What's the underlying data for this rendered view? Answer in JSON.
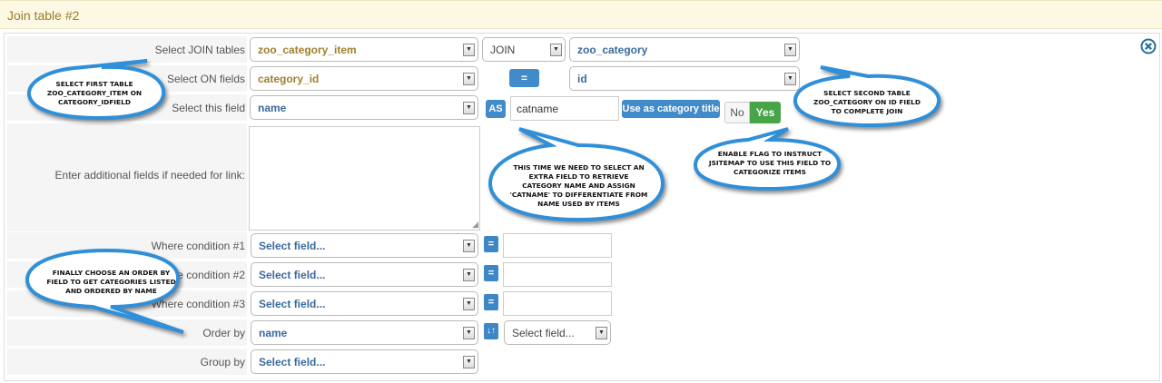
{
  "window": {
    "title": "Join table #2"
  },
  "rows": {
    "join_tables": {
      "label": "Select JOIN tables",
      "table1": "zoo_category_item",
      "join_type": "JOIN",
      "table2": "zoo_category"
    },
    "on_fields": {
      "label": "Select ON fields",
      "field1": "category_id",
      "operator": "=",
      "field2": "id"
    },
    "select_field": {
      "label": "Select this field",
      "field": "name",
      "as_label": "AS",
      "alias": "catname",
      "use_title_button": "Use as category title",
      "no": "No",
      "yes": "Yes"
    },
    "additional": {
      "label": "Enter additional fields if needed for link:",
      "value": ""
    },
    "where1": {
      "label": "Where condition #1",
      "field": "Select field...",
      "operator": "=",
      "value": ""
    },
    "where2": {
      "label": "Where condition #2",
      "field": "Select field...",
      "operator": "=",
      "value": ""
    },
    "where3": {
      "label": "Where condition #3",
      "field": "Select field...",
      "operator": "=",
      "value": ""
    },
    "order_by": {
      "label": "Order by",
      "field": "name",
      "direction_icon": "sort-icon",
      "direction": "Select field..."
    },
    "group_by": {
      "label": "Group by",
      "field": "Select field..."
    }
  },
  "callouts": {
    "first_table": "Select first table zoo_category_item on category_idfield",
    "second_table": "Select second table zoo_category on id field to complete join",
    "extra_field": "This time we need to select an extra field to retrieve category name and assign 'catname' to differentiate from name used by items",
    "enable_flag": "Enable flag to instruct jsitemap to use this field to categorize items",
    "order_by": "Finally choose an order by field to get categories listed and ordered by name"
  },
  "icons": {
    "close": "close-circle-icon",
    "dropdown": "chevron-down-icon"
  },
  "colors": {
    "accent": "#428bca",
    "yes": "#47a447",
    "title": "#9a7d2b",
    "callout_border": "#2f8fd8"
  }
}
